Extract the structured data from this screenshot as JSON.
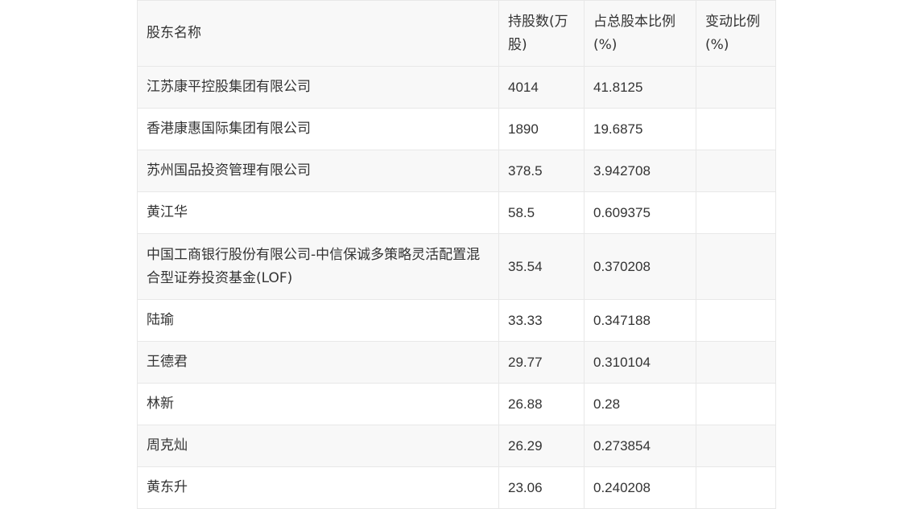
{
  "table": {
    "headers": [
      "股东名称",
      "持股数(万股)",
      "占总股本比例(%)",
      "变动比例(%)"
    ],
    "rows": [
      {
        "name": "江苏康平控股集团有限公司",
        "shares": "4014",
        "ratio": "41.8125",
        "change": ""
      },
      {
        "name": "香港康惠国际集团有限公司",
        "shares": "1890",
        "ratio": "19.6875",
        "change": ""
      },
      {
        "name": "苏州国品投资管理有限公司",
        "shares": "378.5",
        "ratio": "3.942708",
        "change": ""
      },
      {
        "name": "黄江华",
        "shares": "58.5",
        "ratio": "0.609375",
        "change": ""
      },
      {
        "name": "中国工商银行股份有限公司-中信保诚多策略灵活配置混合型证券投资基金(LOF)",
        "shares": "35.54",
        "ratio": "0.370208",
        "change": ""
      },
      {
        "name": "陆瑜",
        "shares": "33.33",
        "ratio": "0.347188",
        "change": ""
      },
      {
        "name": "王德君",
        "shares": "29.77",
        "ratio": "0.310104",
        "change": ""
      },
      {
        "name": "林新",
        "shares": "26.88",
        "ratio": "0.28",
        "change": ""
      },
      {
        "name": "周克灿",
        "shares": "26.29",
        "ratio": "0.273854",
        "change": ""
      },
      {
        "name": "黄东升",
        "shares": "23.06",
        "ratio": "0.240208",
        "change": ""
      }
    ]
  }
}
